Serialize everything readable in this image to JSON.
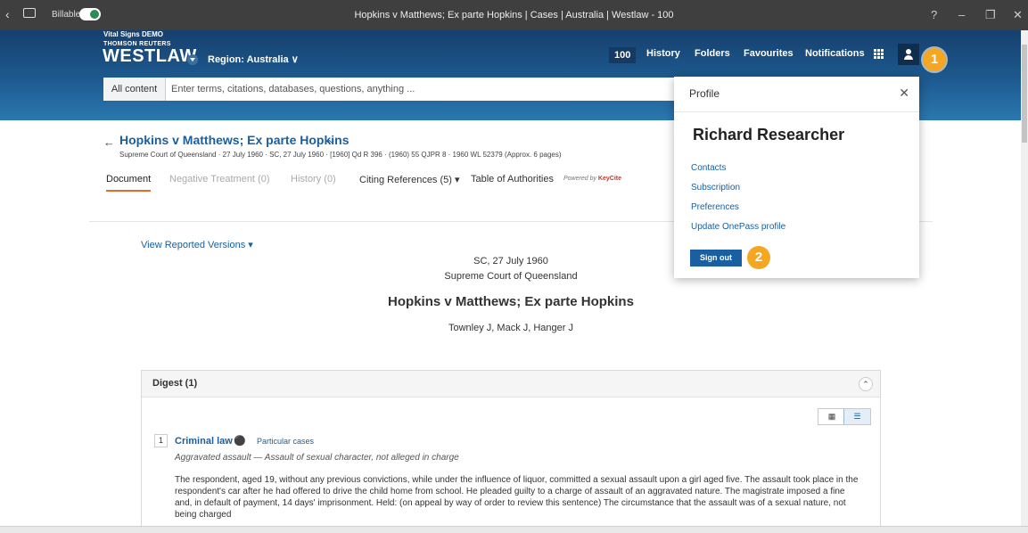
{
  "window": {
    "title": "Hopkins v Matthews; Ex parte Hopkins | Cases | Australia | Westlaw - 100",
    "billable_label": "Billable",
    "controls": {
      "help": "?",
      "minimize": "–",
      "restore": "❐",
      "close": "✕"
    }
  },
  "header": {
    "demo_label": "Vital Signs DEMO",
    "brand_top": "THOMSON REUTERS",
    "brand": "WESTLAW",
    "region": "Region: Australia ∨",
    "nav": {
      "count": "100",
      "history": "History",
      "folders": "Folders",
      "favourites": "Favourites",
      "notifications": "Notifications"
    }
  },
  "search": {
    "scope": "All content",
    "placeholder": "Enter terms, citations, databases, questions, anything ..."
  },
  "document": {
    "title": "Hopkins v Matthews; Ex parte Hopkins",
    "meta": "Supreme Court of Queensland  ·  27 July 1960  ·  SC, 27 July 1960  ·  [1960] Qd R 396  ·  (1960) 55 QJPR 8  ·  1960 WL 52379  (Approx. 6 pages)",
    "tabs": {
      "document": "Document",
      "negative": "Negative Treatment (0)",
      "history": "History (0)",
      "citing": "Citing References (5) ▾",
      "authorities": "Table of Authorities"
    },
    "keycite_prefix": "Powered by",
    "keycite_brand": "KeyCite",
    "reported_versions": "View Reported Versions",
    "court_date": "SC, 27 July 1960",
    "court": "Supreme Court of Queensland",
    "case_heading": "Hopkins v Matthews; Ex parte Hopkins",
    "judges": "Townley J, Mack J, Hanger J"
  },
  "digest": {
    "title": "Digest (1)",
    "number": "1",
    "topic": "Criminal law",
    "subtopic": "Particular cases",
    "headnote": "Aggravated assault — Assault of sexual character, not alleged in charge",
    "body": "The respondent, aged 19, without any previous convictions, while under the influence of liquor, committed a sexual assault upon a girl aged five. The assault took place in the respondent's car after he had offered to drive the child home from school. He pleaded guilty to a charge of assault of an aggravated nature. The magistrate imposed a fine and, in default of payment, 14 days' imprisonment. Held: (on appeal by way of order to review this sentence) The circumstance that the assault was of a sexual nature, not being charged"
  },
  "profile": {
    "title": "Profile",
    "name": "Richard Researcher",
    "links": [
      "Contacts",
      "Subscription",
      "Preferences",
      "Update OnePass profile"
    ],
    "signout": "Sign out"
  },
  "callouts": [
    "1",
    "2"
  ],
  "colors": {
    "accent": "#1a5fa0",
    "header": "#1d5a8f",
    "callout": "#f5a623",
    "active_tab": "#e8682c"
  }
}
